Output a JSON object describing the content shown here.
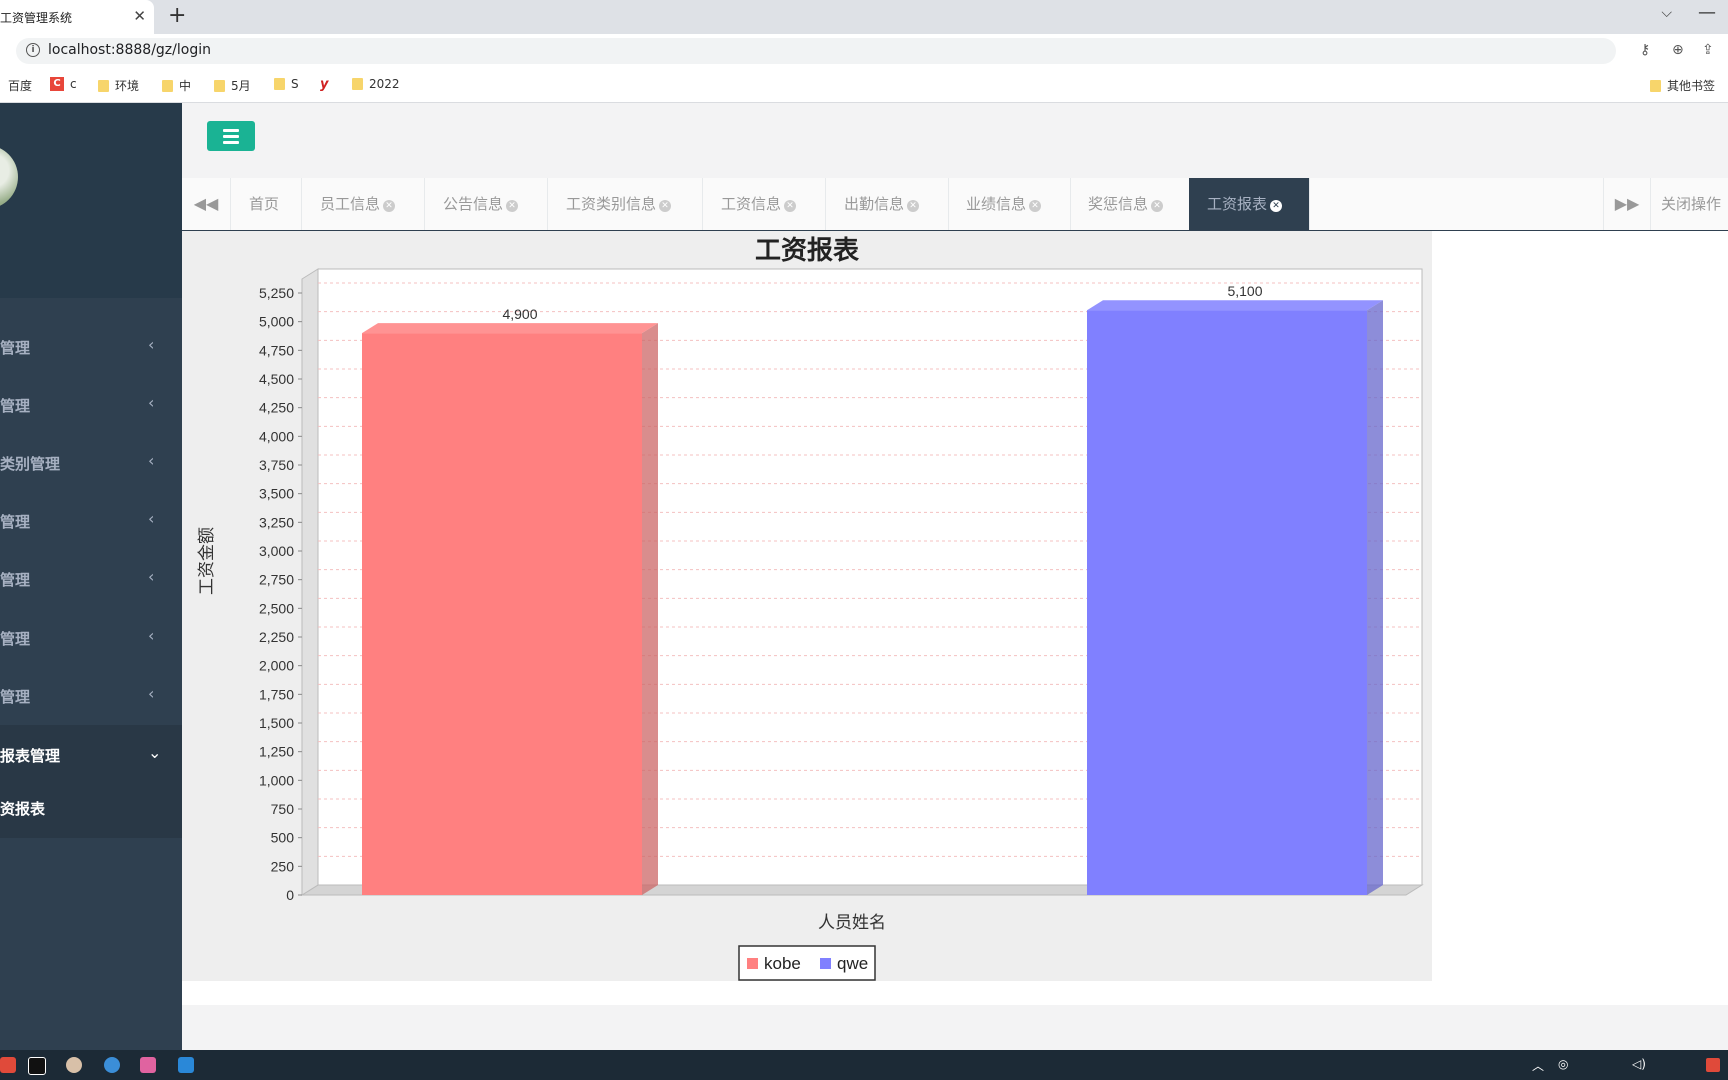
{
  "browser": {
    "tab_title": "工资管理系统",
    "tab_close": "✕",
    "new_tab": "+",
    "url": "localhost:8888/gz/login",
    "bookmarks": [
      "百度",
      "c",
      "环境",
      "中",
      "5月",
      "S",
      "2022"
    ],
    "other_bookmarks": "其他书签"
  },
  "sidebar": {
    "menu": [
      {
        "label": "管理"
      },
      {
        "label": "管理"
      },
      {
        "label": "类别管理"
      },
      {
        "label": "管理"
      },
      {
        "label": "管理"
      },
      {
        "label": "管理"
      },
      {
        "label": "管理"
      },
      {
        "label": "报表管理"
      }
    ],
    "submenu_label": "资报表"
  },
  "tabs": [
    {
      "label": "首页"
    },
    {
      "label": "员工信息"
    },
    {
      "label": "公告信息"
    },
    {
      "label": "工资类别信息"
    },
    {
      "label": "工资信息"
    },
    {
      "label": "出勤信息"
    },
    {
      "label": "业绩信息"
    },
    {
      "label": "奖惩信息"
    },
    {
      "label": "工资报表"
    }
  ],
  "close_ops": "关闭操作",
  "chart_data": {
    "type": "bar",
    "title": "工资报表",
    "xlabel": "人员姓名",
    "ylabel": "工资金额",
    "ylim": [
      0,
      5250
    ],
    "ytick_step": 250,
    "grid": true,
    "legend_position": "bottom",
    "series": [
      {
        "name": "kobe",
        "value": 4900,
        "label": "4,900",
        "color": "#ff8080"
      },
      {
        "name": "qwe",
        "value": 5100,
        "label": "5,100",
        "color": "#8080ff"
      }
    ]
  },
  "colors": {
    "sidebar_bg": "#2f4050",
    "accent": "#1ab394",
    "active_tab_bg": "#2f4050"
  }
}
